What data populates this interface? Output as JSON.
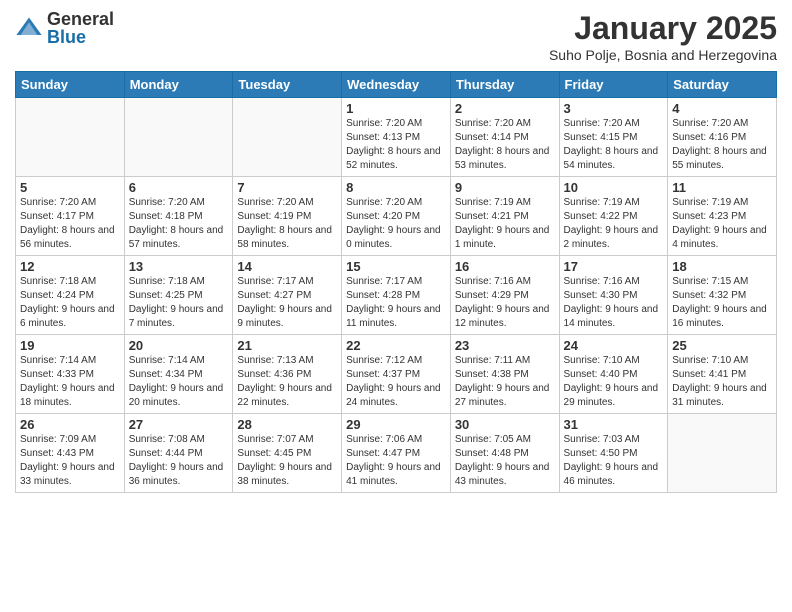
{
  "header": {
    "logo_general": "General",
    "logo_blue": "Blue",
    "month_title": "January 2025",
    "subtitle": "Suho Polje, Bosnia and Herzegovina"
  },
  "days_of_week": [
    "Sunday",
    "Monday",
    "Tuesday",
    "Wednesday",
    "Thursday",
    "Friday",
    "Saturday"
  ],
  "weeks": [
    [
      {
        "day": "",
        "info": ""
      },
      {
        "day": "",
        "info": ""
      },
      {
        "day": "",
        "info": ""
      },
      {
        "day": "1",
        "info": "Sunrise: 7:20 AM\nSunset: 4:13 PM\nDaylight: 8 hours and 52 minutes."
      },
      {
        "day": "2",
        "info": "Sunrise: 7:20 AM\nSunset: 4:14 PM\nDaylight: 8 hours and 53 minutes."
      },
      {
        "day": "3",
        "info": "Sunrise: 7:20 AM\nSunset: 4:15 PM\nDaylight: 8 hours and 54 minutes."
      },
      {
        "day": "4",
        "info": "Sunrise: 7:20 AM\nSunset: 4:16 PM\nDaylight: 8 hours and 55 minutes."
      }
    ],
    [
      {
        "day": "5",
        "info": "Sunrise: 7:20 AM\nSunset: 4:17 PM\nDaylight: 8 hours and 56 minutes."
      },
      {
        "day": "6",
        "info": "Sunrise: 7:20 AM\nSunset: 4:18 PM\nDaylight: 8 hours and 57 minutes."
      },
      {
        "day": "7",
        "info": "Sunrise: 7:20 AM\nSunset: 4:19 PM\nDaylight: 8 hours and 58 minutes."
      },
      {
        "day": "8",
        "info": "Sunrise: 7:20 AM\nSunset: 4:20 PM\nDaylight: 9 hours and 0 minutes."
      },
      {
        "day": "9",
        "info": "Sunrise: 7:19 AM\nSunset: 4:21 PM\nDaylight: 9 hours and 1 minute."
      },
      {
        "day": "10",
        "info": "Sunrise: 7:19 AM\nSunset: 4:22 PM\nDaylight: 9 hours and 2 minutes."
      },
      {
        "day": "11",
        "info": "Sunrise: 7:19 AM\nSunset: 4:23 PM\nDaylight: 9 hours and 4 minutes."
      }
    ],
    [
      {
        "day": "12",
        "info": "Sunrise: 7:18 AM\nSunset: 4:24 PM\nDaylight: 9 hours and 6 minutes."
      },
      {
        "day": "13",
        "info": "Sunrise: 7:18 AM\nSunset: 4:25 PM\nDaylight: 9 hours and 7 minutes."
      },
      {
        "day": "14",
        "info": "Sunrise: 7:17 AM\nSunset: 4:27 PM\nDaylight: 9 hours and 9 minutes."
      },
      {
        "day": "15",
        "info": "Sunrise: 7:17 AM\nSunset: 4:28 PM\nDaylight: 9 hours and 11 minutes."
      },
      {
        "day": "16",
        "info": "Sunrise: 7:16 AM\nSunset: 4:29 PM\nDaylight: 9 hours and 12 minutes."
      },
      {
        "day": "17",
        "info": "Sunrise: 7:16 AM\nSunset: 4:30 PM\nDaylight: 9 hours and 14 minutes."
      },
      {
        "day": "18",
        "info": "Sunrise: 7:15 AM\nSunset: 4:32 PM\nDaylight: 9 hours and 16 minutes."
      }
    ],
    [
      {
        "day": "19",
        "info": "Sunrise: 7:14 AM\nSunset: 4:33 PM\nDaylight: 9 hours and 18 minutes."
      },
      {
        "day": "20",
        "info": "Sunrise: 7:14 AM\nSunset: 4:34 PM\nDaylight: 9 hours and 20 minutes."
      },
      {
        "day": "21",
        "info": "Sunrise: 7:13 AM\nSunset: 4:36 PM\nDaylight: 9 hours and 22 minutes."
      },
      {
        "day": "22",
        "info": "Sunrise: 7:12 AM\nSunset: 4:37 PM\nDaylight: 9 hours and 24 minutes."
      },
      {
        "day": "23",
        "info": "Sunrise: 7:11 AM\nSunset: 4:38 PM\nDaylight: 9 hours and 27 minutes."
      },
      {
        "day": "24",
        "info": "Sunrise: 7:10 AM\nSunset: 4:40 PM\nDaylight: 9 hours and 29 minutes."
      },
      {
        "day": "25",
        "info": "Sunrise: 7:10 AM\nSunset: 4:41 PM\nDaylight: 9 hours and 31 minutes."
      }
    ],
    [
      {
        "day": "26",
        "info": "Sunrise: 7:09 AM\nSunset: 4:43 PM\nDaylight: 9 hours and 33 minutes."
      },
      {
        "day": "27",
        "info": "Sunrise: 7:08 AM\nSunset: 4:44 PM\nDaylight: 9 hours and 36 minutes."
      },
      {
        "day": "28",
        "info": "Sunrise: 7:07 AM\nSunset: 4:45 PM\nDaylight: 9 hours and 38 minutes."
      },
      {
        "day": "29",
        "info": "Sunrise: 7:06 AM\nSunset: 4:47 PM\nDaylight: 9 hours and 41 minutes."
      },
      {
        "day": "30",
        "info": "Sunrise: 7:05 AM\nSunset: 4:48 PM\nDaylight: 9 hours and 43 minutes."
      },
      {
        "day": "31",
        "info": "Sunrise: 7:03 AM\nSunset: 4:50 PM\nDaylight: 9 hours and 46 minutes."
      },
      {
        "day": "",
        "info": ""
      }
    ]
  ]
}
